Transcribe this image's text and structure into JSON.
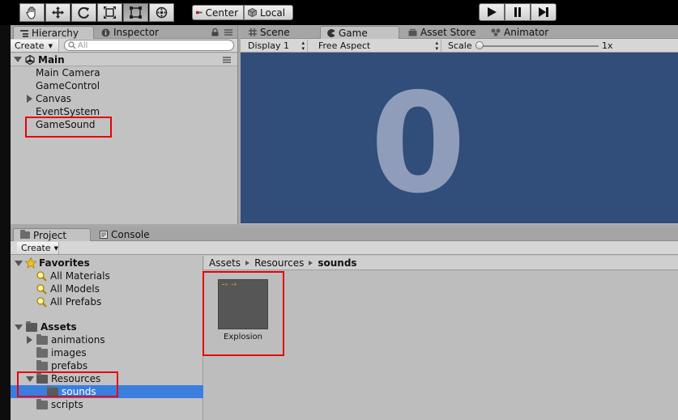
{
  "toolbar": {
    "tools": [
      {
        "name": "hand-tool",
        "icon": "hand-icon"
      },
      {
        "name": "move-tool",
        "icon": "move-arrows-icon"
      },
      {
        "name": "rotate-tool",
        "icon": "rotate-icon"
      },
      {
        "name": "scale-tool",
        "icon": "scale-icon"
      },
      {
        "name": "rect-tool",
        "icon": "rect-icon"
      },
      {
        "name": "transform-tool",
        "icon": "transform-icon"
      }
    ],
    "pivot_label": "Center",
    "space_label": "Local",
    "play_icon": "play-icon",
    "pause_icon": "pause-icon",
    "step_icon": "step-icon"
  },
  "hierarchy": {
    "tab_label": "Hierarchy",
    "inspector_tab_label": "Inspector",
    "create_label": "Create",
    "search_placeholder": "All",
    "scene_name": "Main",
    "items": [
      {
        "label": "Main Camera",
        "expandable": false
      },
      {
        "label": "GameControl",
        "expandable": false
      },
      {
        "label": "Canvas",
        "expandable": true
      },
      {
        "label": "EventSystem",
        "expandable": false
      },
      {
        "label": "GameSound",
        "expandable": false
      }
    ]
  },
  "game_tabs": {
    "scene": "Scene",
    "game": "Game",
    "asset_store": "Asset Store",
    "animator": "Animator"
  },
  "game_controls": {
    "display": "Display 1",
    "aspect": "Free Aspect",
    "scale_label": "Scale",
    "scale_value": "1x",
    "scale_fraction": 0.0
  },
  "game_view": {
    "score": "0",
    "background": "#314d79"
  },
  "project": {
    "tab_label": "Project",
    "console_tab_label": "Console",
    "create_label": "Create",
    "favorites_label": "Favorites",
    "favorites": [
      "All Materials",
      "All Models",
      "All Prefabs"
    ],
    "assets_label": "Assets",
    "folders": [
      {
        "label": "animations",
        "expandable": true,
        "selected": false
      },
      {
        "label": "images",
        "expandable": false,
        "selected": false
      },
      {
        "label": "prefabs",
        "expandable": false,
        "selected": false
      },
      {
        "label": "Resources",
        "expandable": true,
        "selected": false
      },
      {
        "label": "sounds",
        "expandable": false,
        "selected": true
      },
      {
        "label": "scripts",
        "expandable": false,
        "selected": false
      }
    ],
    "breadcrumb": [
      "Assets",
      "Resources",
      "sounds"
    ],
    "assets": [
      {
        "label": "Explosion"
      }
    ]
  },
  "colors": {
    "highlight": "#e8000b",
    "selection": "#3a7ee0",
    "game_bg": "#314d79"
  }
}
